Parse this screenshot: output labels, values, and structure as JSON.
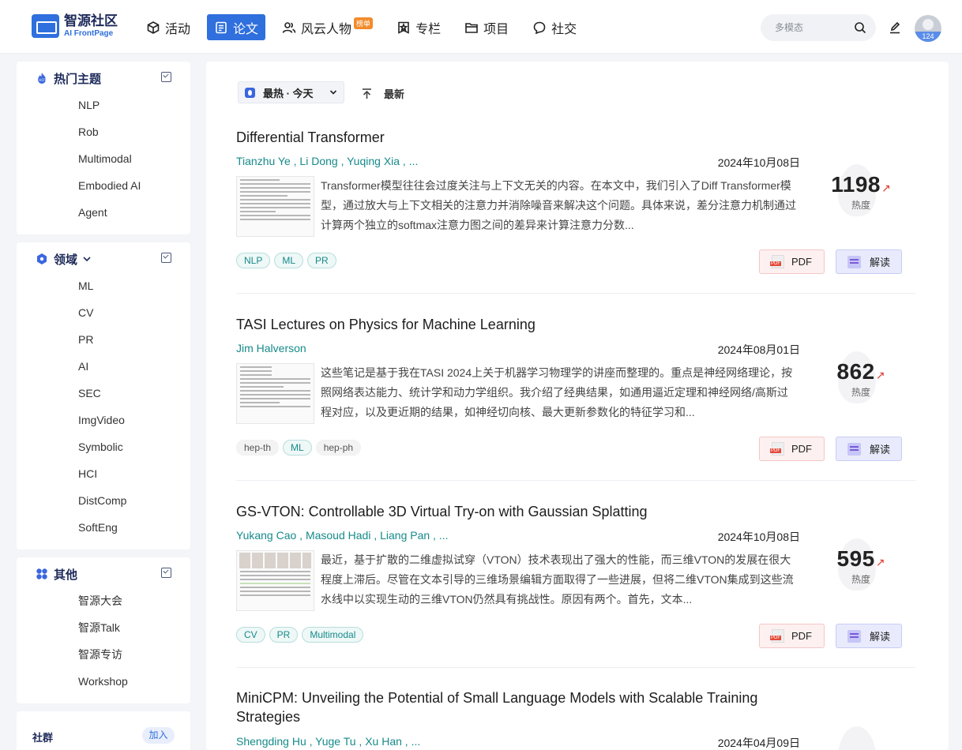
{
  "brand": {
    "title": "智源社区",
    "subtitle": "AI FrontPage"
  },
  "nav": [
    {
      "label": "活动",
      "icon": "cube-icon"
    },
    {
      "label": "论文",
      "icon": "paper-icon",
      "active": true
    },
    {
      "label": "风云人物",
      "icon": "people-icon",
      "badge": "榜单"
    },
    {
      "label": "专栏",
      "icon": "column-icon"
    },
    {
      "label": "项目",
      "icon": "folder-icon"
    },
    {
      "label": "社交",
      "icon": "chat-icon"
    }
  ],
  "search": {
    "placeholder": "多模态"
  },
  "user": {
    "count": "124"
  },
  "sidebar": {
    "hot": {
      "title": "热门主题",
      "items": [
        "NLP",
        "Rob",
        "Multimodal",
        "Embodied AI",
        "Agent"
      ]
    },
    "field": {
      "title": "领域",
      "items": [
        "ML",
        "CV",
        "PR",
        "AI",
        "SEC",
        "ImgVideo",
        "Symbolic",
        "HCI",
        "DistComp",
        "SoftEng"
      ]
    },
    "other": {
      "title": "其他",
      "items": [
        "智源大会",
        "智源Talk",
        "智源专访",
        "Workshop"
      ]
    },
    "community": {
      "title": "社群",
      "join": "加入"
    }
  },
  "toolbar": {
    "sort_label": "最热 · 今天",
    "latest_label": "最新"
  },
  "papers": [
    {
      "title": "Differential Transformer",
      "authors": "Tianzhu Ye , Li Dong , Yuqing Xia , ...",
      "date": "2024年10月08日",
      "abstract": "Transformer模型往往会过度关注与上下文无关的内容。在本文中，我们引入了Diff Transformer模型，通过放大与上下文相关的注意力并消除噪音来解决这个问题。具体来说，差分注意力机制通过计算两个独立的softmax注意力图之间的差异来计算注意力分数...",
      "tags": [
        {
          "label": "NLP",
          "style": "teal"
        },
        {
          "label": "ML",
          "style": "teal"
        },
        {
          "label": "PR",
          "style": "teal"
        }
      ],
      "heat": "1198",
      "heat_label": "热度",
      "pdf_label": "PDF",
      "read_label": "解读"
    },
    {
      "title": "TASI Lectures on Physics for Machine Learning",
      "authors": "Jim Halverson",
      "date": "2024年08月01日",
      "abstract": "这些笔记是基于我在TASI 2024上关于机器学习物理学的讲座而整理的。重点是神经网络理论，按照网络表达能力、统计学和动力学组织。我介绍了经典结果，如通用逼近定理和神经网络/高斯过程对应，以及更近期的结果，如神经切向核、最大更新参数化的特征学习和...",
      "tags": [
        {
          "label": "hep-th",
          "style": "gray"
        },
        {
          "label": "ML",
          "style": "teal"
        },
        {
          "label": "hep-ph",
          "style": "gray"
        }
      ],
      "heat": "862",
      "heat_label": "热度",
      "pdf_label": "PDF",
      "read_label": "解读"
    },
    {
      "title": "GS-VTON: Controllable 3D Virtual Try-on with Gaussian Splatting",
      "authors": "Yukang Cao , Masoud Hadi , Liang Pan , ...",
      "date": "2024年10月08日",
      "abstract": "最近，基于扩散的二维虚拟试穿（VTON）技术表现出了强大的性能，而三维VTON的发展在很大程度上滞后。尽管在文本引导的三维场景编辑方面取得了一些进展，但将二维VTON集成到这些流水线中以实现生动的三维VTON仍然具有挑战性。原因有两个。首先，文本...",
      "tags": [
        {
          "label": "CV",
          "style": "teal"
        },
        {
          "label": "PR",
          "style": "teal"
        },
        {
          "label": "Multimodal",
          "style": "teal"
        }
      ],
      "heat": "595",
      "heat_label": "热度",
      "pdf_label": "PDF",
      "read_label": "解读"
    },
    {
      "title": "MiniCPM: Unveiling the Potential of Small Language Models with Scalable Training Strategies",
      "authors": "Shengding Hu , Yuge Tu , Xu Han , ...",
      "date": "2024年04月09日"
    }
  ],
  "colors": {
    "accent": "#2f6fde",
    "tag_teal": "#178a8a",
    "heat_arrow": "#e0352b"
  }
}
